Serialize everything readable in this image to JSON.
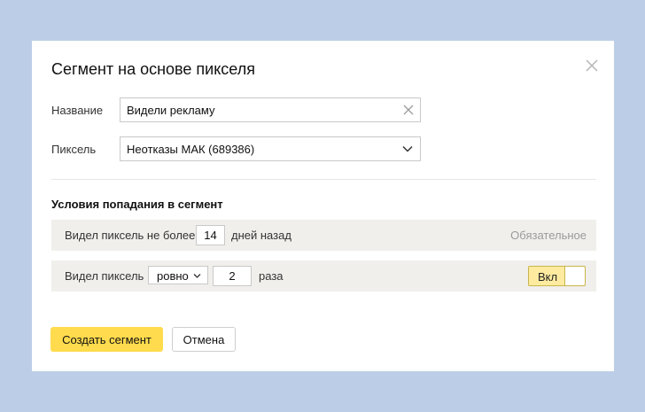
{
  "dialog": {
    "title": "Сегмент на основе пикселя",
    "close_icon": "close-icon"
  },
  "form": {
    "name": {
      "label": "Название",
      "value": "Видели рекламу",
      "clear_icon": "clear-icon"
    },
    "pixel": {
      "label": "Пиксель",
      "value": "Неотказы МАК (689386)",
      "dropdown_icon": "chevron-down-icon"
    }
  },
  "conditions": {
    "title": "Условия попадания в сегмент",
    "row1": {
      "prefix": "Видел пиксель не более",
      "days": "14",
      "suffix": "дней назад",
      "required": "Обязательное"
    },
    "row2": {
      "prefix": "Видел пиксель",
      "mode": "ровно",
      "count": "2",
      "suffix": "раза",
      "toggle_label": "Вкл",
      "toggle_on": true
    }
  },
  "actions": {
    "create_label": "Создать сегмент",
    "cancel_label": "Отмена"
  },
  "colors": {
    "backdrop": "#bccde7",
    "primary_button": "#ffdb4d",
    "toggle_on": "#ffeba0",
    "row_background": "#f0efec"
  }
}
